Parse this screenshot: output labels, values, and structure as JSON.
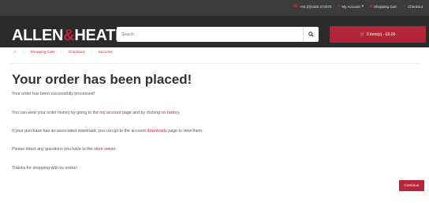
{
  "topbar": {
    "links": [
      {
        "label": "+44 (0)1326 372070",
        "icon": "phone-icon"
      },
      {
        "label": "My Account",
        "icon": "user-icon"
      },
      {
        "label": "Shopping Cart",
        "icon": "cart-icon"
      },
      {
        "label": "Checkout",
        "icon": "share-icon"
      }
    ]
  },
  "header": {
    "logo_left": "ALLEN",
    "logo_amp": "&",
    "logo_right": "HEATH",
    "search_placeholder": "Search",
    "cart_label": "0 item(s) - £0.00"
  },
  "breadcrumb": {
    "items": [
      "Shopping Cart",
      "Checkout",
      "Success"
    ]
  },
  "page": {
    "title": "Your order has been placed!",
    "p1": "Your order has been successfully processed!",
    "p2_a": "You can view your order history by going to the ",
    "p2_link1": "my account",
    "p2_b": " page and by clicking on ",
    "p2_link2": "history",
    "p2_c": ".",
    "p3_a": "If your purchase has an associated download, you can go to the account ",
    "p3_link": "downloads",
    "p3_b": " page to view them.",
    "p4_a": "Please direct any questions you have to the ",
    "p4_link": "store owner",
    "p4_b": ".",
    "p5": "Thanks for shopping with us online!",
    "continue_label": "Continue"
  },
  "colors": {
    "brand_red": "#b3263a",
    "header_dark": "#2b2b2b",
    "topbar": "#3c3c3c"
  }
}
